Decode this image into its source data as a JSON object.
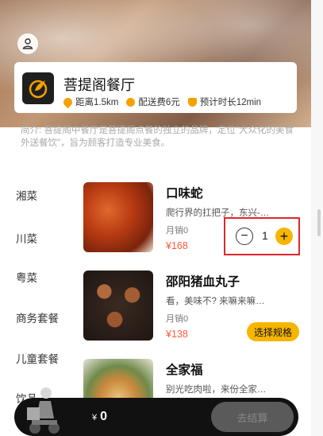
{
  "colors": {
    "accent": "#f7b500",
    "price": "#ff5a3c",
    "highlight_box": "#e0262b",
    "cart_bar": "#111111"
  },
  "header": {
    "user_icon": "user-icon"
  },
  "shop": {
    "name": "菩提阁餐厅",
    "distance": "距离1.5km",
    "delivery_fee": "配送费6元",
    "eta": "预计时长12min",
    "intro": "简介: 菩提阁中餐厅是菩提阁点餐的独立的品牌，定位\"大众化的美食外送餐饮\"，旨为顾客打造专业美食。"
  },
  "categories": [
    "湘菜",
    "川菜",
    "粤菜",
    "商务套餐",
    "儿童套餐",
    "饮品"
  ],
  "dishes": [
    {
      "name": "口味蛇",
      "desc": "爬行界的扛把子，东兴-…",
      "sales": "月销0",
      "price": "¥168"
    },
    {
      "name": "邵阳猪血丸子",
      "desc": "看，美味不? 来嘛来嘛…",
      "sales": "月销0",
      "price": "¥138",
      "spec_label": "选择规格"
    },
    {
      "name": "全家福",
      "desc": "别光吃肉啦，来份全家…"
    }
  ],
  "stepper": {
    "minus": "−",
    "count": "1",
    "plus": "+"
  },
  "cart": {
    "currency": "¥",
    "total": "0",
    "checkout_label": "去结算"
  }
}
